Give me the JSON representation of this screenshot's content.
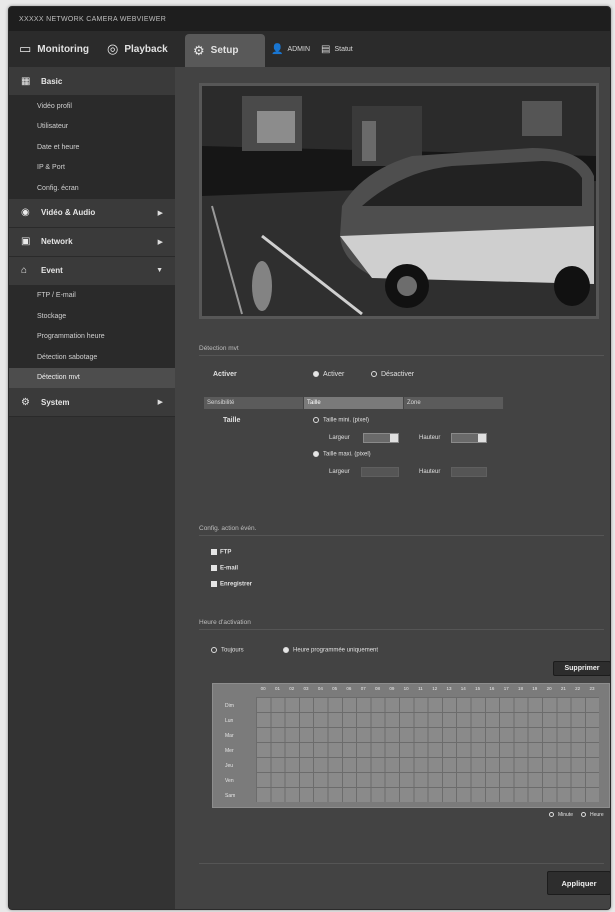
{
  "titlebar": {
    "title": "XXXXX NETWORK CAMERA WEBVIEWER"
  },
  "topnav": {
    "monitoring": "Monitoring",
    "playback": "Playback",
    "setup": "Setup",
    "admin": "ADMIN",
    "status": "Statut"
  },
  "sidebar": {
    "basic": {
      "label": "Basic",
      "items": [
        "Vidéo profil",
        "Utilisateur",
        "Date et heure",
        "IP & Port",
        "Config. écran"
      ]
    },
    "video_audio": "Vidéo & Audio",
    "network": "Network",
    "event": {
      "label": "Event",
      "items": [
        "FTP / E-mail",
        "Stockage",
        "Programmation heure",
        "Détection sabotage",
        "Détection mvt"
      ]
    },
    "system": "System"
  },
  "main": {
    "section_motion": "Détection mvt",
    "activate_label": "Activer",
    "activate_on": "Activer",
    "activate_off": "Désactiver",
    "tabs": [
      "Sensibilité",
      "Taille",
      "Zone"
    ],
    "size_label": "Taille",
    "min_size": "Taille mini. (pixel)",
    "max_size": "Taille maxi. (pixel)",
    "width": "Largeur",
    "height": "Hauteur",
    "min_width_value": "",
    "min_height_value": "",
    "section_actions": "Config. action évén.",
    "actions": [
      "FTP",
      "E-mail",
      "Enregistrer"
    ],
    "section_time": "Heure d'activation",
    "time_always": "Toujours",
    "time_scheduled": "Heure programmée uniquement",
    "delete_button": "Supprimer",
    "hours": [
      "00",
      "01",
      "02",
      "03",
      "04",
      "05",
      "06",
      "07",
      "08",
      "09",
      "10",
      "11",
      "12",
      "13",
      "14",
      "15",
      "16",
      "17",
      "18",
      "19",
      "20",
      "21",
      "22",
      "23"
    ],
    "days": [
      "Dim",
      "Lun",
      "Mar",
      "Mer",
      "Jeu",
      "Ven",
      "Sam"
    ],
    "minute_label": "Minute",
    "hour_label": "Heure",
    "apply_button": "Appliquer"
  }
}
